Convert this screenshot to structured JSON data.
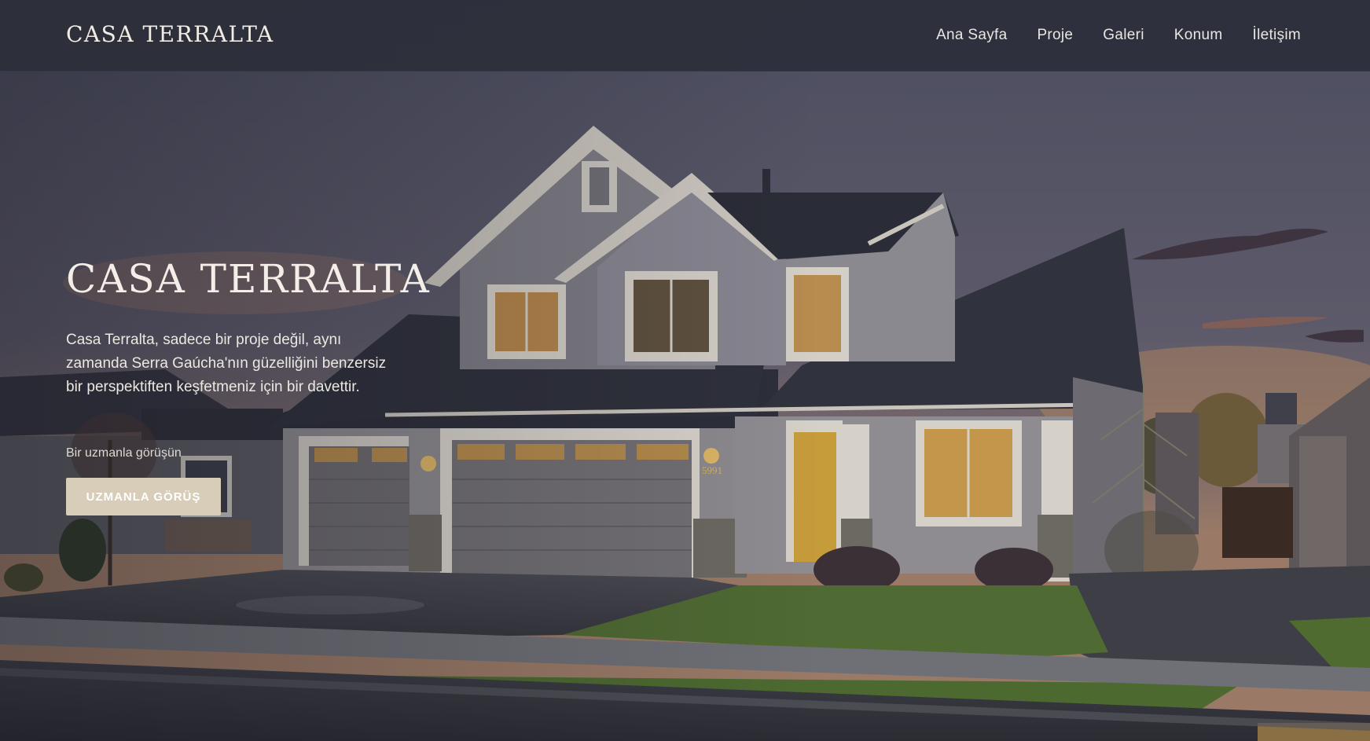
{
  "header": {
    "brand": "CASA TERRALTA",
    "nav": [
      {
        "label": "Ana Sayfa"
      },
      {
        "label": "Proje"
      },
      {
        "label": "Galeri"
      },
      {
        "label": "Konum"
      },
      {
        "label": "İletişim"
      }
    ]
  },
  "hero": {
    "title": "CASA TERRALTA",
    "description": "Casa Terralta, sadece bir proje değil, aynı zamanda Serra Gaúcha'nın güzelliğini benzersiz bir perspektiften keşfetmeniz için bir davettir.",
    "subtext": "Bir uzmanla görüşün",
    "cta_label": "UZMANLA GÖRÜŞ",
    "image": "house-at-dusk-photo",
    "house_number": "5991"
  },
  "colors": {
    "topbar": "#2c2e3a",
    "cta": "#d8cdb9",
    "text": "#f3efe8"
  }
}
